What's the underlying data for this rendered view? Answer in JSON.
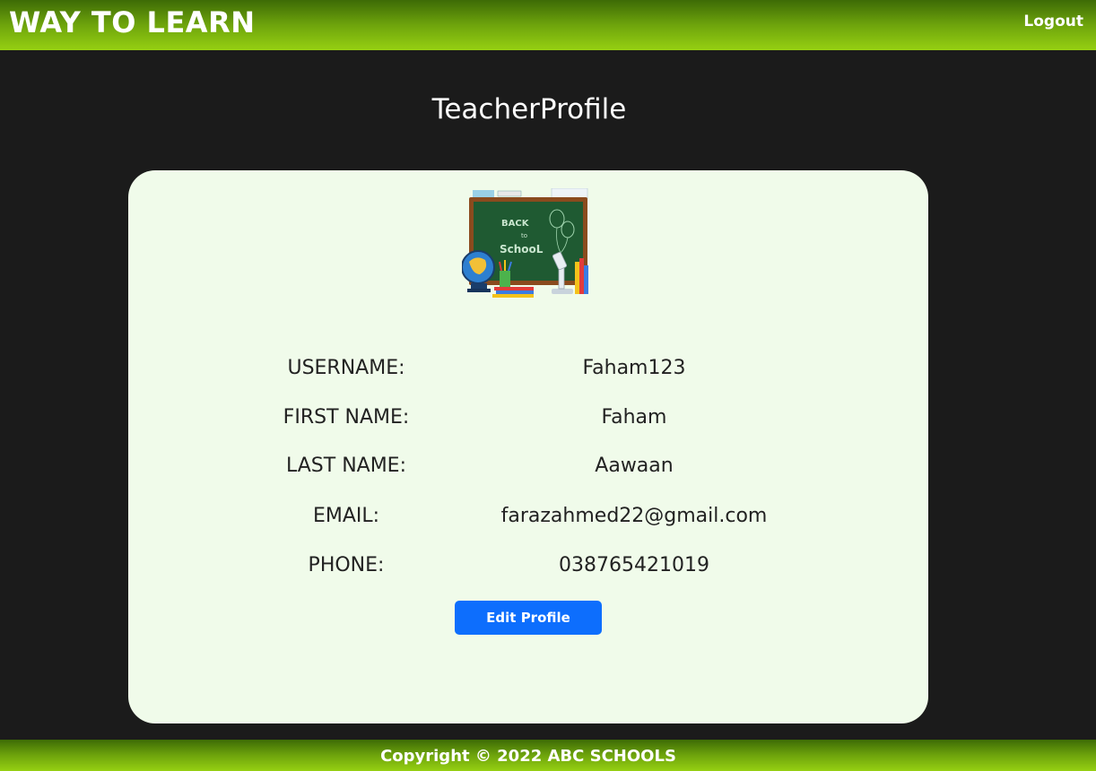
{
  "header": {
    "brand": "WAY TO LEARN",
    "logout_label": "Logout"
  },
  "page": {
    "title": "TeacherProfile"
  },
  "profile": {
    "image": {
      "board_text_1": "BACK",
      "board_text_2": "to",
      "board_text_3": "SchooL"
    },
    "rows": [
      {
        "label": "USERNAME:",
        "value": "Faham123"
      },
      {
        "label": "FIRST NAME:",
        "value": "Faham"
      },
      {
        "label": "LAST NAME:",
        "value": "Aawaan"
      },
      {
        "label": "EMAIL:",
        "value": "farazahmed22@gmail.com"
      },
      {
        "label": "PHONE:",
        "value": "038765421019"
      }
    ],
    "edit_label": "Edit Profile"
  },
  "footer": {
    "text": "Copyright © 2022 ABC SCHOOLS"
  },
  "colors": {
    "background": "#1b1b1b",
    "bar_dark": "#3d6b06",
    "bar_light": "#96d012",
    "card": "#f0fbea",
    "button": "#0d6efd"
  }
}
